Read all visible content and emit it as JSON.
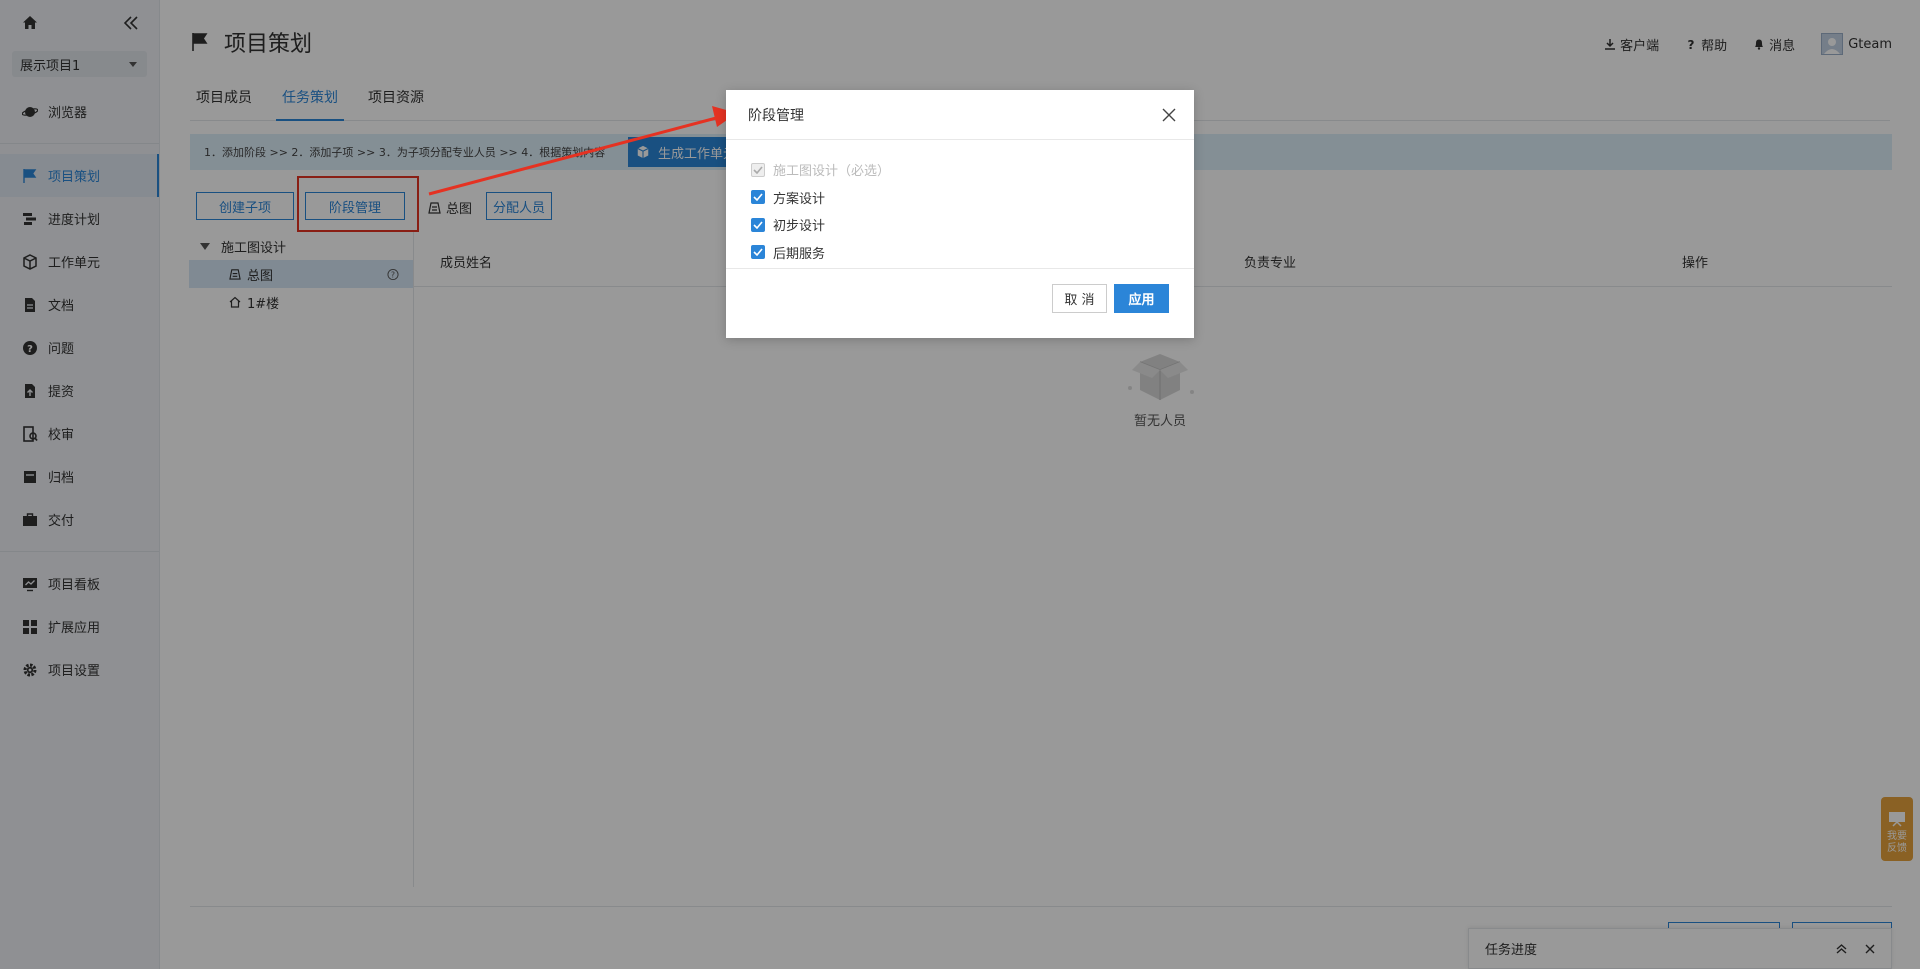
{
  "sidebar": {
    "project": "展示项目1",
    "items": [
      {
        "label": "浏览器",
        "icon": "planet-icon"
      },
      {
        "label": "项目策划",
        "icon": "flag-icon",
        "active": true
      },
      {
        "label": "进度计划",
        "icon": "gantt-icon"
      },
      {
        "label": "工作单元",
        "icon": "cube-icon"
      },
      {
        "label": "文档",
        "icon": "document-icon"
      },
      {
        "label": "问题",
        "icon": "question-icon"
      },
      {
        "label": "提资",
        "icon": "upload-doc-icon"
      },
      {
        "label": "校审",
        "icon": "review-icon"
      },
      {
        "label": "归档",
        "icon": "archive-icon"
      },
      {
        "label": "交付",
        "icon": "briefcase-icon"
      }
    ],
    "items2": [
      {
        "label": "项目看板",
        "icon": "board-icon"
      },
      {
        "label": "扩展应用",
        "icon": "apps-icon"
      },
      {
        "label": "项目设置",
        "icon": "gear-icon"
      }
    ]
  },
  "header": {
    "title": "项目策划",
    "client": "客户端",
    "help": "帮助",
    "messages": "消息",
    "user": "Gteam"
  },
  "tabs": [
    "项目成员",
    "任务策划",
    "项目资源"
  ],
  "steps": {
    "text": "1．添加阶段  >>  2．添加子项  >>  3．为子项分配专业人员  >>  4．根据策划内容",
    "generate_button": "生成工作单元"
  },
  "actions": {
    "create_sub": "创建子项",
    "stage_manage": "阶段管理",
    "current_node": "总图",
    "assign": "分配人员"
  },
  "tree": {
    "root": "施工图设计",
    "children": [
      "总图",
      "1#楼"
    ]
  },
  "table": {
    "columns": [
      "成员姓名",
      "负责专业",
      "操作"
    ],
    "empty_text": "暂无人员"
  },
  "task_panel": {
    "title": "任务进度"
  },
  "feedback": {
    "line1": "我要",
    "line2": "反馈"
  },
  "modal": {
    "title": "阶段管理",
    "options": [
      {
        "label": "施工图设计（必选）",
        "checked": true,
        "disabled": true
      },
      {
        "label": "方案设计",
        "checked": true,
        "disabled": false
      },
      {
        "label": "初步设计",
        "checked": true,
        "disabled": false
      },
      {
        "label": "后期服务",
        "checked": true,
        "disabled": false
      }
    ],
    "cancel": "取 消",
    "apply": "应用"
  },
  "colors": {
    "accent": "#2b85d8",
    "highlight": "#e53222",
    "feedback": "#e6a23c"
  }
}
